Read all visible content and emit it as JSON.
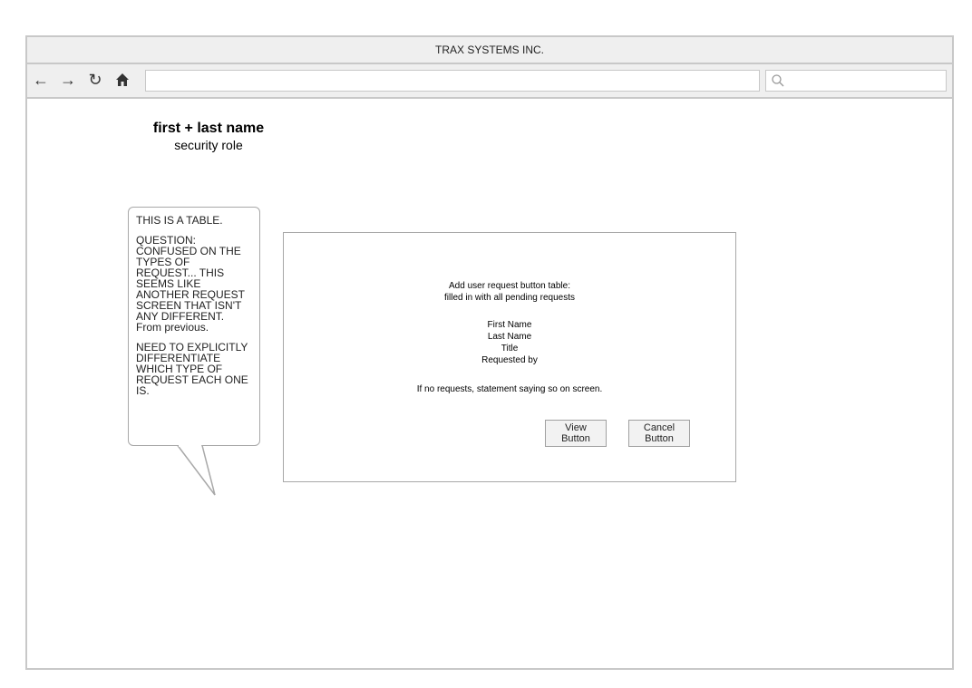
{
  "window": {
    "title": "TRAX SYSTEMS INC."
  },
  "toolbar": {
    "back_icon": "←",
    "forward_icon": "→",
    "reload_icon": "↻",
    "home_icon": "⌂",
    "url_value": "",
    "search_value": ""
  },
  "user": {
    "name": "first + last name",
    "role": "security role"
  },
  "callout": {
    "p1": "THIS IS A TABLE.",
    "p2": "QUESTION: CONFUSED ON THE TYPES OF REQUEST... THIS SEEMS LIKE ANOTHER REQUEST SCREEN THAT ISN'T ANY DIFFERENT. From previous.",
    "p3": "NEED TO EXPLICITLY DIFFERENTIATE WHICH TYPE OF REQUEST EACH ONE IS."
  },
  "panel": {
    "line1": "Add user request button table:",
    "line2": "filled in with all pending requests",
    "fields": [
      "First Name",
      "Last Name",
      "Title",
      "Requested by"
    ],
    "empty_note": "If no requests, statement saying so on screen.",
    "view_line1": "View",
    "view_line2": "Button",
    "cancel_line1": "Cancel",
    "cancel_line2": "Button"
  }
}
